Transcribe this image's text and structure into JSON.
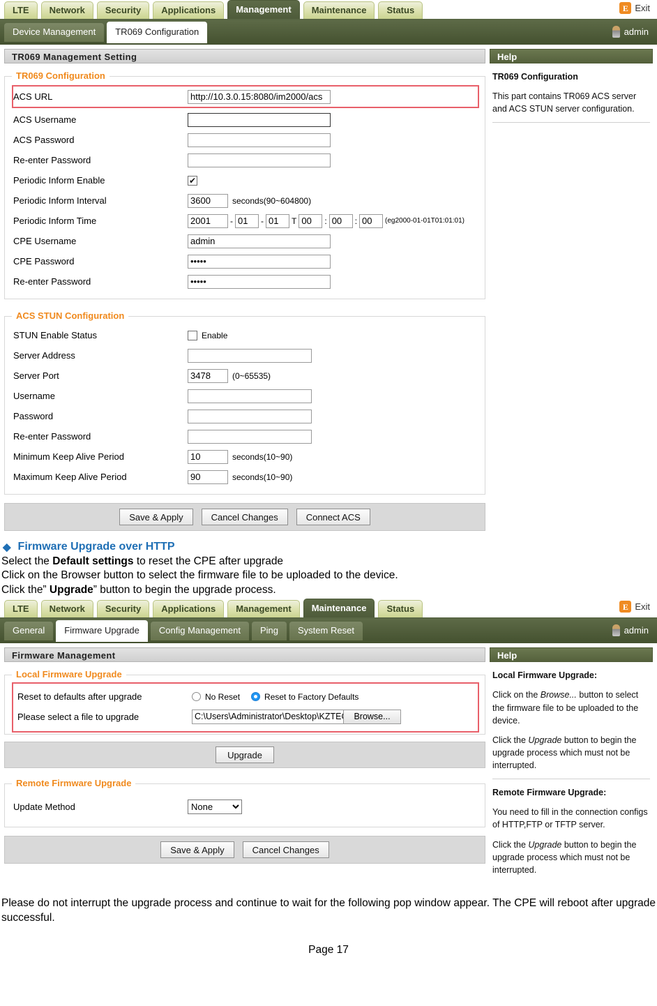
{
  "screen1": {
    "main_tabs": [
      {
        "label": "LTE",
        "active": false
      },
      {
        "label": "Network",
        "active": false
      },
      {
        "label": "Security",
        "active": false
      },
      {
        "label": "Applications",
        "active": false
      },
      {
        "label": "Management",
        "active": true
      },
      {
        "label": "Maintenance",
        "active": false
      },
      {
        "label": "Status",
        "active": false
      }
    ],
    "exit_label": "Exit",
    "exit_icon": "exit-icon",
    "sub_tabs": [
      {
        "label": "Device Management",
        "active": false
      },
      {
        "label": "TR069 Configuration",
        "active": true
      }
    ],
    "user_label": "admin",
    "panel_title": "TR069 Management Setting",
    "tr069": {
      "legend": "TR069 Configuration",
      "acs_url_label": "ACS URL",
      "acs_url_value": "http://10.3.0.15:8080/im2000/acs",
      "acs_username_label": "ACS Username",
      "acs_username_value": "",
      "acs_password_label": "ACS Password",
      "acs_password_value": "",
      "acs_reenter_label": "Re-enter Password",
      "acs_reenter_value": "",
      "periodic_enable_label": "Periodic Inform Enable",
      "periodic_enable_checked": "✔",
      "periodic_interval_label": "Periodic Inform Interval",
      "periodic_interval_value": "3600",
      "periodic_interval_hint": "seconds(90~604800)",
      "periodic_time_label": "Periodic Inform Time",
      "time_year": "2001",
      "time_month": "01",
      "time_day": "01",
      "time_hour": "00",
      "time_minute": "00",
      "time_second": "00",
      "time_sep_dash": "-",
      "time_sep_t": "T",
      "time_sep_colon": ":",
      "time_hint": "(eg2000-01-01T01:01:01)",
      "cpe_username_label": "CPE Username",
      "cpe_username_value": "admin",
      "cpe_password_label": "CPE Password",
      "cpe_password_value": "•••••",
      "cpe_reenter_label": "Re-enter Password",
      "cpe_reenter_value": "•••••"
    },
    "stun": {
      "legend": "ACS STUN Configuration",
      "enable_status_label": "STUN Enable Status",
      "enable_checkbox_label": "Enable",
      "enable_checked": false,
      "server_address_label": "Server Address",
      "server_address_value": "",
      "server_port_label": "Server Port",
      "server_port_value": "3478",
      "server_port_hint": "(0~65535)",
      "username_label": "Username",
      "username_value": "",
      "password_label": "Password",
      "password_value": "",
      "reenter_label": "Re-enter Password",
      "reenter_value": "",
      "min_keepalive_label": "Minimum Keep Alive Period",
      "min_keepalive_value": "10",
      "min_keepalive_hint": "seconds(10~90)",
      "max_keepalive_label": "Maximum Keep Alive Period",
      "max_keepalive_value": "90",
      "max_keepalive_hint": "seconds(10~90)"
    },
    "buttons": {
      "save": "Save & Apply",
      "cancel": "Cancel Changes",
      "connect": "Connect ACS"
    },
    "help": {
      "title": "Help",
      "heading": "TR069 Configuration",
      "text": "This part contains TR069 ACS server and ACS STUN server configuration."
    }
  },
  "doc": {
    "bullet_glyph": "◆",
    "heading": "Firmware Upgrade over HTTP",
    "line1_a": "Select the ",
    "line1_b": "Default settings",
    "line1_c": " to reset the CPE after upgrade",
    "line2": "Click on the Browser button to select the firmware file to be uploaded to the device.",
    "line3_a": "Click the” ",
    "line3_b": "Upgrade",
    "line3_c": "” button to begin the upgrade process.",
    "closing": "Please do not interrupt the upgrade process and continue to wait for the following pop window appear. The CPE will reboot after upgrade successful.",
    "page_number": "Page 17"
  },
  "screen2": {
    "main_tabs": [
      {
        "label": "LTE",
        "active": false
      },
      {
        "label": "Network",
        "active": false
      },
      {
        "label": "Security",
        "active": false
      },
      {
        "label": "Applications",
        "active": false
      },
      {
        "label": "Management",
        "active": false
      },
      {
        "label": "Maintenance",
        "active": true
      },
      {
        "label": "Status",
        "active": false
      }
    ],
    "exit_label": "Exit",
    "sub_tabs": [
      {
        "label": "General",
        "active": false
      },
      {
        "label": "Firmware Upgrade",
        "active": true
      },
      {
        "label": "Config Management",
        "active": false
      },
      {
        "label": "Ping",
        "active": false
      },
      {
        "label": "System Reset",
        "active": false
      }
    ],
    "user_label": "admin",
    "panel_title": "Firmware Management",
    "local": {
      "legend": "Local Firmware Upgrade",
      "reset_label": "Reset to defaults after upgrade",
      "radio_no_reset": "No Reset",
      "radio_factory": "Reset to Factory Defaults",
      "selected_radio": "Reset to Factory Defaults",
      "file_label": "Please select a file to upgrade",
      "file_path": "C:\\Users\\Administrator\\Desktop\\KZTECH_AM",
      "browse_label": "Browse...",
      "upgrade_button": "Upgrade"
    },
    "remote": {
      "legend": "Remote Firmware Upgrade",
      "update_method_label": "Update Method",
      "update_method_value": "None",
      "update_method_options": [
        "None"
      ]
    },
    "buttons": {
      "save": "Save & Apply",
      "cancel": "Cancel Changes"
    },
    "help": {
      "title": "Help",
      "local_heading": "Local Firmware Upgrade:",
      "local_p1_a": "Click on the ",
      "local_p1_b": "Browse...",
      "local_p1_c": " button to select the firmware file to be uploaded to the device.",
      "local_p2_a": "Click the ",
      "local_p2_b": "Upgrade",
      "local_p2_c": " button to begin the upgrade process which must not be interrupted.",
      "remote_heading": "Remote Firmware Upgrade:",
      "remote_p1": "You need to fill in the connection configs of HTTP,FTP or TFTP server.",
      "remote_p2_a": "Click the ",
      "remote_p2_b": "Upgrade",
      "remote_p2_c": " button to begin the upgrade process which must not be interrupted."
    }
  },
  "colors": {
    "tab_active": "#4e5b3a",
    "tab_inactive": "#dfe4b4",
    "legend_orange": "#f08a1e",
    "heading_blue": "#1f6fb5",
    "highlight_red": "#e8606a",
    "exit_orange": "#ef8b22"
  }
}
